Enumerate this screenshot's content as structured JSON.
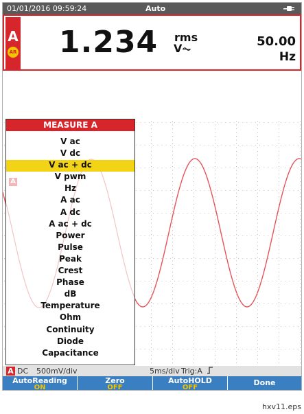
{
  "status_bar": {
    "timestamp": "01/01/2016 09:59:24",
    "mode": "Auto",
    "icon": "power-plug-icon"
  },
  "reading": {
    "channel": "A",
    "auto_range_badge": "AR",
    "value": "1.234",
    "unit_top": "rms",
    "unit_bottom": "V⏦",
    "frequency_value": "50.00",
    "frequency_unit": "Hz"
  },
  "menu": {
    "title": "MEASURE A",
    "selected_index": 2,
    "items": [
      "V ac",
      "V dc",
      "V ac + dc",
      "V pwm",
      "Hz",
      "A ac",
      "A dc",
      "A ac + dc",
      "Power",
      "Pulse",
      "Peak",
      "Crest",
      "Phase",
      "dB",
      "Temperature",
      "Ohm",
      "Continuity",
      "Diode",
      "Capacitance"
    ],
    "trace_marker_label": "A"
  },
  "info_bar": {
    "channel": "A",
    "coupling": "DC",
    "volts_per_div": "500mV/div",
    "time_per_div": "5ms/div",
    "trigger": "Trig:A",
    "trigger_slope_icon": "rising-edge-icon"
  },
  "softkeys": [
    {
      "label": "AutoReading",
      "state": "ON"
    },
    {
      "label": "Zero",
      "state": "OFF"
    },
    {
      "label": "AutoHOLD",
      "state": "OFF"
    },
    {
      "label": "Done",
      "state": ""
    }
  ],
  "caption": "hxv11.eps",
  "colors": {
    "accent_red": "#d7262b",
    "waveform": "#e5545a",
    "selection_yellow": "#f2d316",
    "softkey_blue": "#3a7fc2",
    "state_yellow": "#f2c500",
    "status_bar_gray": "#5a5a5a"
  }
}
